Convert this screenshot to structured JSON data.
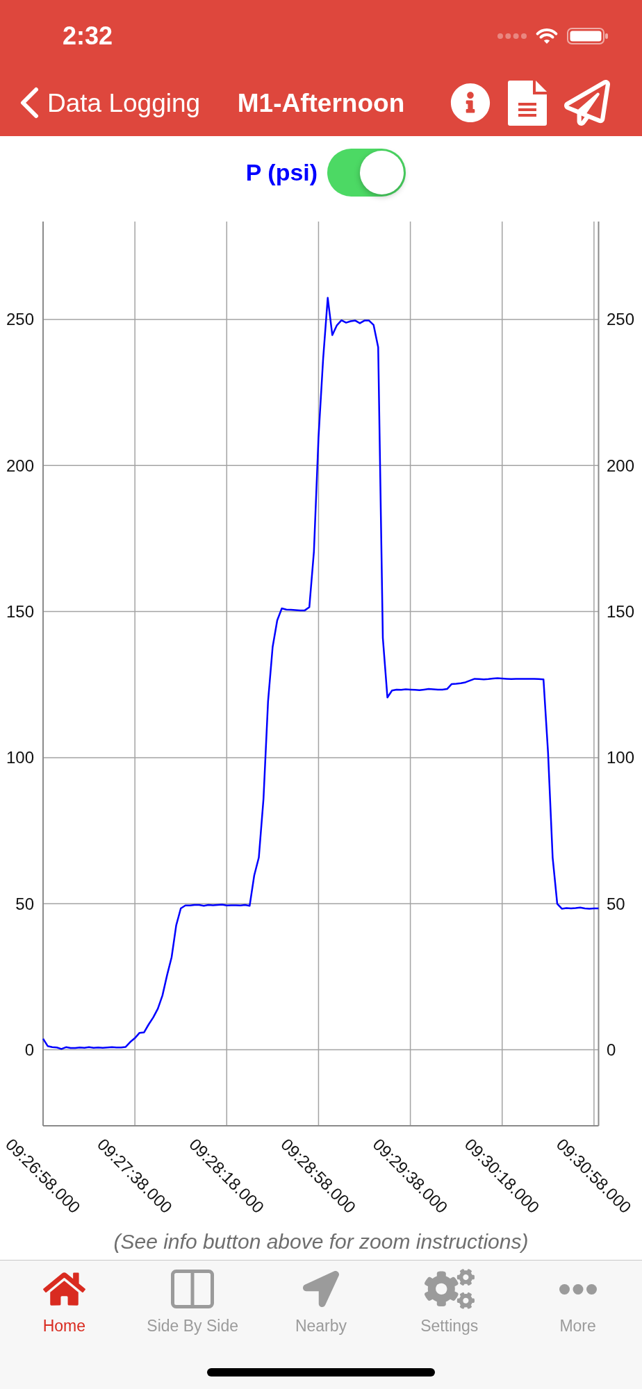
{
  "status_bar": {
    "time": "2:32"
  },
  "nav_bar": {
    "back_label": "Data Logging",
    "title": "M1-Afternoon"
  },
  "series_toggle": {
    "label": "P (psi)",
    "on": true
  },
  "chart": {
    "chart_data": {
      "type": "line",
      "grid": true,
      "categories": [
        "09:26:58.000",
        null,
        null,
        null,
        null,
        null,
        null,
        null,
        null,
        null,
        null,
        null,
        null,
        null,
        null,
        null,
        null,
        null,
        null,
        null,
        "09:27:38.000",
        null,
        null,
        null,
        null,
        null,
        null,
        null,
        null,
        null,
        null,
        null,
        null,
        null,
        null,
        null,
        null,
        null,
        null,
        null,
        "09:28:18.000",
        null,
        null,
        null,
        null,
        null,
        null,
        null,
        null,
        null,
        null,
        null,
        null,
        null,
        null,
        null,
        null,
        null,
        null,
        null,
        "09:28:58.000",
        null,
        null,
        null,
        null,
        null,
        null,
        null,
        null,
        null,
        null,
        null,
        null,
        null,
        null,
        null,
        null,
        null,
        null,
        null,
        "09:29:38.000",
        null,
        null,
        null,
        null,
        null,
        null,
        null,
        null,
        null,
        null,
        null,
        null,
        null,
        null,
        null,
        null,
        null,
        null,
        null,
        "09:30:18.000",
        null,
        null,
        null,
        null,
        null,
        null,
        null,
        null,
        null,
        null,
        null,
        null,
        null,
        null,
        null,
        null,
        null,
        null,
        null,
        "09:30:58.000",
        null
      ],
      "series": [
        {
          "color": "#0000ff",
          "values": [
            3.8,
            1.3,
            0.9,
            0.8,
            0.3,
            0.9,
            0.6,
            0.6,
            0.8,
            0.7,
            0.9,
            0.7,
            0.8,
            0.7,
            0.8,
            0.9,
            0.8,
            0.8,
            1.0,
            2.7,
            4.0,
            5.8,
            6.0,
            8.7,
            11.1,
            14.1,
            18.6,
            25.5,
            31.7,
            42.6,
            48.4,
            49.4,
            49.4,
            49.6,
            49.6,
            49.3,
            49.6,
            49.5,
            49.6,
            49.7,
            49.4,
            49.5,
            49.5,
            49.4,
            49.6,
            49.3,
            59.7,
            65.8,
            85.8,
            119.3,
            137.9,
            147.0,
            151.1,
            150.7,
            150.6,
            150.5,
            150.4,
            150.4,
            151.5,
            170.5,
            209.6,
            236.6,
            257.4,
            244.6,
            248.0,
            249.7,
            248.9,
            249.4,
            249.6,
            248.7,
            249.6,
            249.6,
            248.1,
            240.5,
            141.0,
            120.6,
            123.0,
            123.3,
            123.2,
            123.4,
            123.3,
            123.2,
            123.1,
            123.3,
            123.5,
            123.4,
            123.3,
            123.3,
            123.5,
            125.2,
            125.3,
            125.5,
            125.8,
            126.4,
            127.0,
            126.9,
            126.8,
            126.9,
            127.1,
            127.2,
            127.1,
            127.0,
            126.9,
            127.0,
            127.0,
            127.0,
            127.0,
            127.0,
            126.9,
            126.8,
            101.6,
            65.8,
            50.0,
            48.3,
            48.5,
            48.4,
            48.5,
            48.7,
            48.4,
            48.3,
            48.4,
            48.4
          ]
        }
      ],
      "ylim": [
        -26,
        283.5
      ],
      "yticks": [
        0,
        50,
        100,
        150,
        200,
        250
      ],
      "y2lim": [
        -26,
        283.5
      ],
      "y2ticks": [
        0,
        50,
        100,
        150,
        200,
        250
      ]
    }
  },
  "hint": "(See info button above for zoom instructions)",
  "tab_bar": [
    {
      "label": "Home",
      "kind": "home",
      "selected": true
    },
    {
      "label": "Side By Side",
      "kind": "split",
      "selected": false
    },
    {
      "label": "Nearby",
      "kind": "nearby",
      "selected": false
    },
    {
      "label": "Settings",
      "kind": "settings",
      "selected": false
    },
    {
      "label": "More",
      "kind": "more",
      "selected": false
    }
  ]
}
